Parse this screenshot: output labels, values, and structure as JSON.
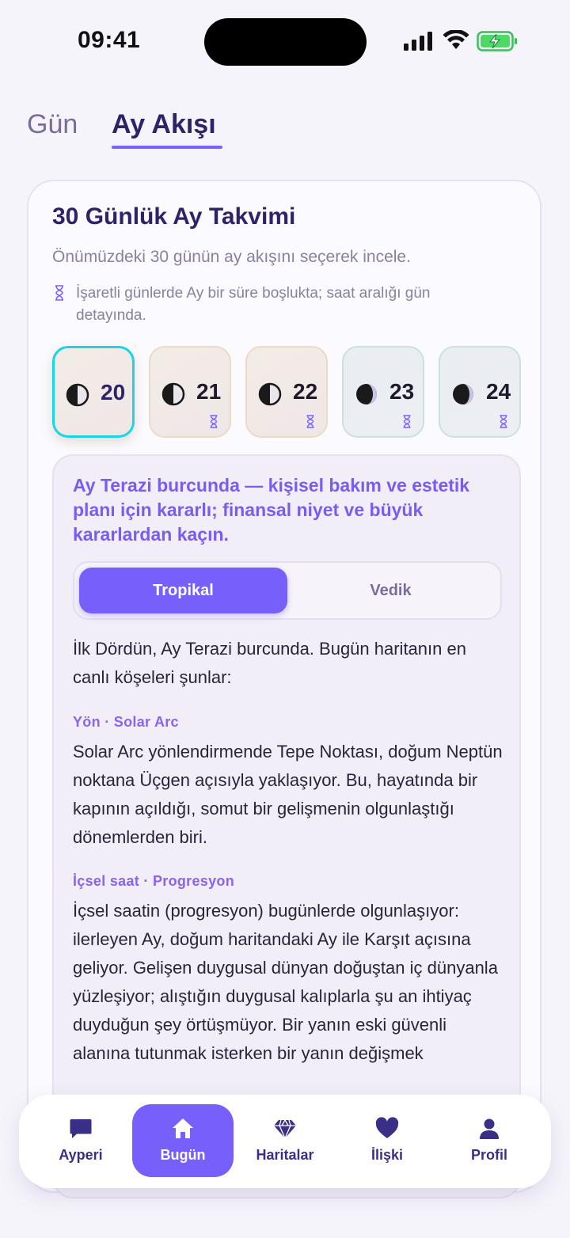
{
  "status_bar": {
    "time": "09:41"
  },
  "tabs": [
    {
      "label": "Gün"
    },
    {
      "label": "Ay Akışı"
    }
  ],
  "calendar": {
    "title": "30 Günlük Ay Takvimi",
    "subtitle": "Önümüzdeki 30 günün ay akışını seçerek incele.",
    "note": "İşaretli günlerde Ay bir süre boşlukta; saat aralığı gün detayında.",
    "days": [
      {
        "day": "20",
        "moon": "first-quarter-icon",
        "void": false,
        "selected": true
      },
      {
        "day": "21",
        "moon": "first-quarter-icon",
        "void": true,
        "selected": false
      },
      {
        "day": "22",
        "moon": "first-quarter-icon",
        "void": true,
        "selected": false
      },
      {
        "day": "23",
        "moon": "waxing-gibbous-icon",
        "void": true,
        "selected": false
      },
      {
        "day": "24",
        "moon": "waxing-gibbous-icon",
        "void": true,
        "selected": false
      }
    ]
  },
  "detail": {
    "headline": "Ay Terazi burcunda — kişisel bakım ve estetik planı için kararlı; finansal niyet ve büyük kararlardan kaçın.",
    "segment": {
      "tropical": "Tropikal",
      "vedic": "Vedik",
      "selected": "Tropikal"
    },
    "intro": "İlk Dördün, Ay Terazi burcunda. Bugün haritanın en canlı köşeleri şunlar:",
    "sections": [
      {
        "label": "Yön · Solar Arc",
        "text": "Solar Arc yönlendirmende Tepe Noktası, doğum Neptün noktana Üçgen açısıyla yaklaşıyor. Bu, hayatında bir kapının açıldığı, somut bir gelişmenin olgunlaştığı dönemlerden biri."
      },
      {
        "label": "İçsel saat · Progresyon",
        "text": "İçsel saatin (progresyon) bugünlerde olgunlaşıyor: ilerleyen Ay, doğum haritandaki Ay ile Karşıt açısına geliyor. Gelişen duygusal dünyan doğuştan iç dünyanla yüzleşiyor; alıştığın duygusal kalıplarla şu an ihtiyaç duyduğun şey örtüşmüyor. Bir yanın eski güvenli alanına tutunmak isterken bir yanın değişmek"
      }
    ]
  },
  "bottom_nav": [
    {
      "label": "Ayperi",
      "icon": "chat-bubble-icon",
      "active": false
    },
    {
      "label": "Bugün",
      "icon": "home-icon",
      "active": true
    },
    {
      "label": "Haritalar",
      "icon": "diamond-icon",
      "active": false
    },
    {
      "label": "İlişki",
      "icon": "heart-icon",
      "active": false
    },
    {
      "label": "Profil",
      "icon": "person-icon",
      "active": false
    }
  ],
  "colors": {
    "accent": "#775ffb",
    "title": "#2e2369",
    "selected_ring": "#19d5e6"
  }
}
